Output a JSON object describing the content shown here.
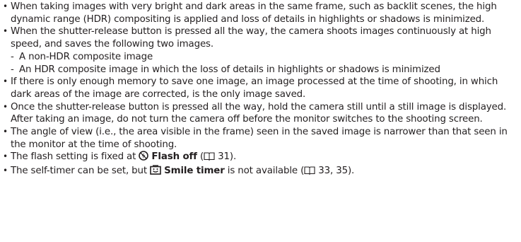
{
  "bullets": [
    {
      "text": "When taking images with very bright and dark areas in the same frame, such as backlit scenes, the high dynamic range (HDR) compositing is applied and loss of details in highlights or shadows is minimized."
    },
    {
      "text": "When the shutter-release button is pressed all the way, the camera shoots images continuously at high speed, and saves the following two images.",
      "subitems": [
        "A non-HDR composite image",
        "An HDR composite image in which the loss of details in highlights or shadows is minimized"
      ]
    },
    {
      "text": "If there is only enough memory to save one image, an image processed at the time of shooting, in which dark areas of the image are corrected, is the only image saved."
    },
    {
      "text": "Once the shutter-release button is pressed all the way, hold the camera still until a still image is displayed. After taking an image, do not turn the camera off before the monitor switches to the shooting screen."
    },
    {
      "text": "The angle of view (i.e., the area visible in the frame) seen in the saved image is narrower than that seen in the monitor at the time of shooting."
    },
    {
      "text_before": "The flash setting is fixed at",
      "icon": "flash-off-icon",
      "bold": "Flash off",
      "paren_open": "(",
      "ref_icon": "book-reference-icon",
      "ref_pages": "31",
      "text_after": ")."
    },
    {
      "text_before": "The self-timer can be set, but",
      "icon": "smile-timer-icon",
      "bold": "Smile timer",
      "text_middle": "is not available (",
      "ref_icon": "book-reference-icon",
      "ref_pages": "33, 35",
      "text_after": ")."
    }
  ],
  "bullet_glyph": "•",
  "dash_glyph": "-"
}
